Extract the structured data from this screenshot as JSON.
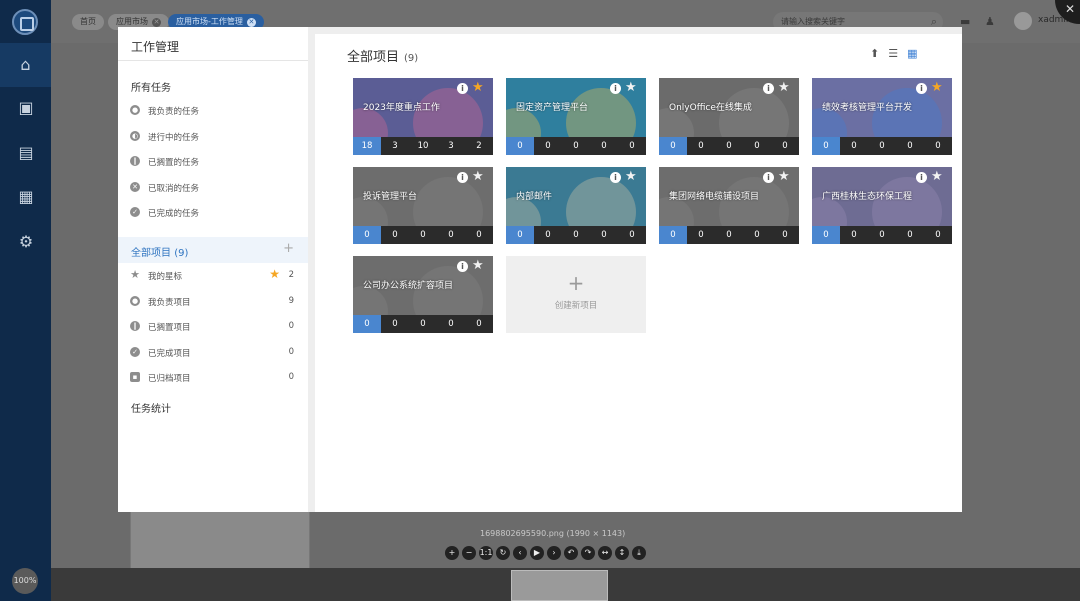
{
  "app": {
    "tabs": [
      {
        "label": "首页",
        "closable": false
      },
      {
        "label": "应用市场",
        "closable": true
      },
      {
        "label": "应用市场-工作管理",
        "closable": true,
        "active": true
      }
    ],
    "search_placeholder": "请输入搜索关键字",
    "username": "xadmin",
    "zoom": "100%"
  },
  "viewer": {
    "filename": "1698802695590.png (1990 × 1143)",
    "tools": [
      "+",
      "−",
      "1:1",
      "↻",
      "‹",
      "▶",
      "›",
      "↶",
      "↷",
      "↔",
      "↕",
      "⤓"
    ]
  },
  "sidebar": {
    "title": "工作管理",
    "all_tasks_label": "所有任务",
    "tasks": [
      {
        "label": "我负责的任务",
        "icon": "user-icon"
      },
      {
        "label": "进行中的任务",
        "icon": "in-progress-icon"
      },
      {
        "label": "已搁置的任务",
        "icon": "pause-icon"
      },
      {
        "label": "已取消的任务",
        "icon": "cancel-icon"
      },
      {
        "label": "已完成的任务",
        "icon": "check-icon"
      }
    ],
    "projects_label": "全部项目",
    "projects_count": "(9)",
    "project_filters": [
      {
        "label": "我的星标",
        "icon": "star-icon",
        "count": "2",
        "starred": true
      },
      {
        "label": "我负责项目",
        "icon": "user-icon",
        "count": "9"
      },
      {
        "label": "已搁置项目",
        "icon": "pause-icon",
        "count": "0"
      },
      {
        "label": "已完成项目",
        "icon": "check-icon",
        "count": "0"
      },
      {
        "label": "已归档项目",
        "icon": "archive-icon",
        "count": "0"
      }
    ],
    "stats_label": "任务统计"
  },
  "main": {
    "title": "全部项目",
    "count": "(9)",
    "projects": [
      {
        "name": "2023年度重点工作",
        "starred": true,
        "stats": [
          "18",
          "3",
          "10",
          "3",
          "2"
        ],
        "bg": "#5b5d95",
        "accent": "#d96a92"
      },
      {
        "name": "固定资产管理平台",
        "starred": false,
        "stats": [
          "0",
          "0",
          "0",
          "0",
          "0"
        ],
        "bg": "#2f7f9e",
        "accent": "#f0c24a"
      },
      {
        "name": "OnlyOffice在线集成",
        "starred": false,
        "stats": [
          "0",
          "0",
          "0",
          "0",
          "0"
        ],
        "bg": "#6b6b6b",
        "accent": "#8c8c8c"
      },
      {
        "name": "绩效考核管理平台开发",
        "starred": true,
        "stats": [
          "0",
          "0",
          "0",
          "0",
          "0"
        ],
        "bg": "#6b6fa3",
        "accent": "#3e7fd8"
      },
      {
        "name": "投诉管理平台",
        "starred": false,
        "stats": [
          "0",
          "0",
          "0",
          "0",
          "0"
        ],
        "bg": "#6d6d6d",
        "accent": "#858585"
      },
      {
        "name": "内部邮件",
        "starred": false,
        "stats": [
          "0",
          "0",
          "0",
          "0",
          "0"
        ],
        "bg": "#3b7a93",
        "accent": "#d8c8a8"
      },
      {
        "name": "集团网络电缆铺设项目",
        "starred": false,
        "stats": [
          "0",
          "0",
          "0",
          "0",
          "0"
        ],
        "bg": "#6d6d6d",
        "accent": "#858585"
      },
      {
        "name": "广西桂林生态环保工程",
        "starred": false,
        "stats": [
          "0",
          "0",
          "0",
          "0",
          "0"
        ],
        "bg": "#6e6c93",
        "accent": "#9a8bb8"
      },
      {
        "name": "公司办公系统扩容项目",
        "starred": false,
        "stats": [
          "0",
          "0",
          "0",
          "0",
          "0"
        ],
        "bg": "#6d6d6d",
        "accent": "#858585"
      }
    ],
    "new_project_label": "创建新项目"
  }
}
